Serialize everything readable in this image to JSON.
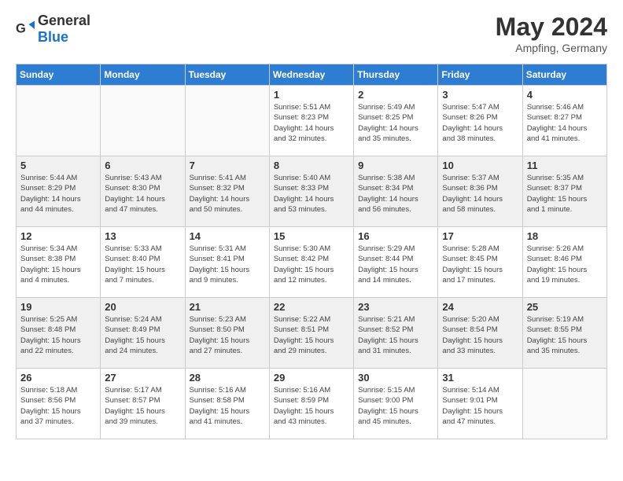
{
  "header": {
    "logo_general": "General",
    "logo_blue": "Blue",
    "month_title": "May 2024",
    "subtitle": "Ampfing, Germany"
  },
  "days_of_week": [
    "Sunday",
    "Monday",
    "Tuesday",
    "Wednesday",
    "Thursday",
    "Friday",
    "Saturday"
  ],
  "weeks": [
    [
      {
        "day": "",
        "info": ""
      },
      {
        "day": "",
        "info": ""
      },
      {
        "day": "",
        "info": ""
      },
      {
        "day": "1",
        "info": "Sunrise: 5:51 AM\nSunset: 8:23 PM\nDaylight: 14 hours\nand 32 minutes."
      },
      {
        "day": "2",
        "info": "Sunrise: 5:49 AM\nSunset: 8:25 PM\nDaylight: 14 hours\nand 35 minutes."
      },
      {
        "day": "3",
        "info": "Sunrise: 5:47 AM\nSunset: 8:26 PM\nDaylight: 14 hours\nand 38 minutes."
      },
      {
        "day": "4",
        "info": "Sunrise: 5:46 AM\nSunset: 8:27 PM\nDaylight: 14 hours\nand 41 minutes."
      }
    ],
    [
      {
        "day": "5",
        "info": "Sunrise: 5:44 AM\nSunset: 8:29 PM\nDaylight: 14 hours\nand 44 minutes."
      },
      {
        "day": "6",
        "info": "Sunrise: 5:43 AM\nSunset: 8:30 PM\nDaylight: 14 hours\nand 47 minutes."
      },
      {
        "day": "7",
        "info": "Sunrise: 5:41 AM\nSunset: 8:32 PM\nDaylight: 14 hours\nand 50 minutes."
      },
      {
        "day": "8",
        "info": "Sunrise: 5:40 AM\nSunset: 8:33 PM\nDaylight: 14 hours\nand 53 minutes."
      },
      {
        "day": "9",
        "info": "Sunrise: 5:38 AM\nSunset: 8:34 PM\nDaylight: 14 hours\nand 56 minutes."
      },
      {
        "day": "10",
        "info": "Sunrise: 5:37 AM\nSunset: 8:36 PM\nDaylight: 14 hours\nand 58 minutes."
      },
      {
        "day": "11",
        "info": "Sunrise: 5:35 AM\nSunset: 8:37 PM\nDaylight: 15 hours\nand 1 minute."
      }
    ],
    [
      {
        "day": "12",
        "info": "Sunrise: 5:34 AM\nSunset: 8:38 PM\nDaylight: 15 hours\nand 4 minutes."
      },
      {
        "day": "13",
        "info": "Sunrise: 5:33 AM\nSunset: 8:40 PM\nDaylight: 15 hours\nand 7 minutes."
      },
      {
        "day": "14",
        "info": "Sunrise: 5:31 AM\nSunset: 8:41 PM\nDaylight: 15 hours\nand 9 minutes."
      },
      {
        "day": "15",
        "info": "Sunrise: 5:30 AM\nSunset: 8:42 PM\nDaylight: 15 hours\nand 12 minutes."
      },
      {
        "day": "16",
        "info": "Sunrise: 5:29 AM\nSunset: 8:44 PM\nDaylight: 15 hours\nand 14 minutes."
      },
      {
        "day": "17",
        "info": "Sunrise: 5:28 AM\nSunset: 8:45 PM\nDaylight: 15 hours\nand 17 minutes."
      },
      {
        "day": "18",
        "info": "Sunrise: 5:26 AM\nSunset: 8:46 PM\nDaylight: 15 hours\nand 19 minutes."
      }
    ],
    [
      {
        "day": "19",
        "info": "Sunrise: 5:25 AM\nSunset: 8:48 PM\nDaylight: 15 hours\nand 22 minutes."
      },
      {
        "day": "20",
        "info": "Sunrise: 5:24 AM\nSunset: 8:49 PM\nDaylight: 15 hours\nand 24 minutes."
      },
      {
        "day": "21",
        "info": "Sunrise: 5:23 AM\nSunset: 8:50 PM\nDaylight: 15 hours\nand 27 minutes."
      },
      {
        "day": "22",
        "info": "Sunrise: 5:22 AM\nSunset: 8:51 PM\nDaylight: 15 hours\nand 29 minutes."
      },
      {
        "day": "23",
        "info": "Sunrise: 5:21 AM\nSunset: 8:52 PM\nDaylight: 15 hours\nand 31 minutes."
      },
      {
        "day": "24",
        "info": "Sunrise: 5:20 AM\nSunset: 8:54 PM\nDaylight: 15 hours\nand 33 minutes."
      },
      {
        "day": "25",
        "info": "Sunrise: 5:19 AM\nSunset: 8:55 PM\nDaylight: 15 hours\nand 35 minutes."
      }
    ],
    [
      {
        "day": "26",
        "info": "Sunrise: 5:18 AM\nSunset: 8:56 PM\nDaylight: 15 hours\nand 37 minutes."
      },
      {
        "day": "27",
        "info": "Sunrise: 5:17 AM\nSunset: 8:57 PM\nDaylight: 15 hours\nand 39 minutes."
      },
      {
        "day": "28",
        "info": "Sunrise: 5:16 AM\nSunset: 8:58 PM\nDaylight: 15 hours\nand 41 minutes."
      },
      {
        "day": "29",
        "info": "Sunrise: 5:16 AM\nSunset: 8:59 PM\nDaylight: 15 hours\nand 43 minutes."
      },
      {
        "day": "30",
        "info": "Sunrise: 5:15 AM\nSunset: 9:00 PM\nDaylight: 15 hours\nand 45 minutes."
      },
      {
        "day": "31",
        "info": "Sunrise: 5:14 AM\nSunset: 9:01 PM\nDaylight: 15 hours\nand 47 minutes."
      },
      {
        "day": "",
        "info": ""
      }
    ]
  ]
}
